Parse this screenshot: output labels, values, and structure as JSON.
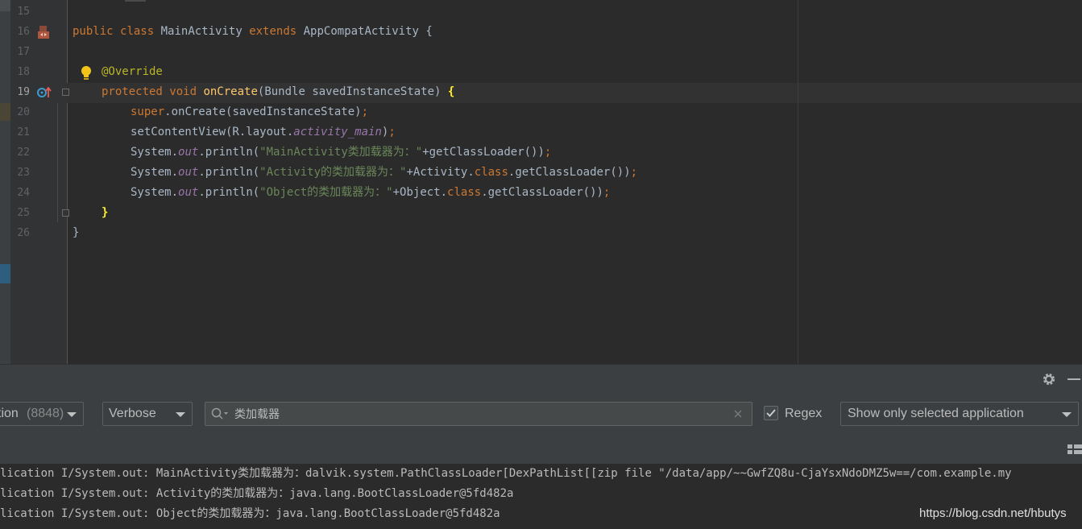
{
  "editor": {
    "line_numbers": [
      "15",
      "16",
      "17",
      "18",
      "19",
      "20",
      "21",
      "22",
      "23",
      "24",
      "25",
      "26"
    ],
    "current_line": "19",
    "code": {
      "l16": {
        "public": "public",
        "class": "class",
        "name": " MainActivity ",
        "extends": "extends",
        "parent": " AppCompatActivity {"
      },
      "l18": {
        "annotation": "@Override"
      },
      "l19": {
        "protected": "protected",
        "void": "void",
        "method": "onCreate",
        "params": "(Bundle savedInstanceState) ",
        "brace": "{"
      },
      "l20": {
        "super": "super",
        "rest": ".onCreate(savedInstanceState)",
        "semi": ";"
      },
      "l21": {
        "pre": "setContentView(R.layout.",
        "field": "activity_main",
        "post": ")",
        "semi": ";"
      },
      "l22": {
        "pre": "System.",
        "field": "out",
        "mid": ".println(",
        "str": "\"MainActivity类加载器为：\"",
        "post": "+getClassLoader())",
        "semi": ";"
      },
      "l23": {
        "pre": "System.",
        "field": "out",
        "mid": ".println(",
        "str": "\"Activity的类加载器为：\"",
        "post1": "+Activity.",
        "cls": "class",
        "post2": ".getClassLoader())",
        "semi": ";"
      },
      "l24": {
        "pre": "System.",
        "field": "out",
        "mid": ".println(",
        "str": "\"Object的类加载器为：\"",
        "post1": "+Object.",
        "cls": "class",
        "post2": ".getClassLoader())",
        "semi": ";"
      },
      "l25": {
        "brace": "}"
      },
      "l26": {
        "brace": "}"
      }
    }
  },
  "logcat": {
    "process_label": "tion",
    "process_pid": "(8848)",
    "level": "Verbose",
    "search_value": "类加载器",
    "regex_label": "Regex",
    "regex_checked": true,
    "filter": "Show only selected application",
    "lines": [
      "lication I/System.out: MainActivity类加载器为：dalvik.system.PathClassLoader[DexPathList[[zip file \"/data/app/~~GwfZQ8u-CjaYsxNdoDMZ5w==/com.example.my",
      "lication I/System.out: Activity的类加载器为：java.lang.BootClassLoader@5fd482a",
      "lication I/System.out: Object的类加载器为：java.lang.BootClassLoader@5fd482a"
    ]
  },
  "watermark": "https://blog.csdn.net/hbutys",
  "icons": {
    "gutter_16": "class-run-icon",
    "gutter_18": "intention-bulb-icon",
    "gutter_19": "override-method-icon",
    "panel_settings": "gear-icon",
    "panel_hide": "minimize-icon",
    "search": "search-icon",
    "clear": "clear-icon",
    "layout": "layout-icon"
  },
  "colors": {
    "keyword": "#cc7832",
    "string": "#6a8759",
    "field": "#9876aa",
    "method": "#ffc66d",
    "annotation": "#bbb529",
    "text": "#a9b7c6",
    "background": "#2b2b2b"
  }
}
